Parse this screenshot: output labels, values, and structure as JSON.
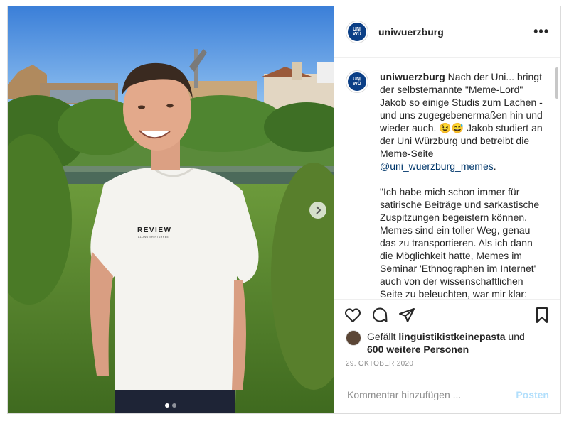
{
  "account": {
    "username": "uniwuerzburg",
    "avatar_text": "UNI WÜ"
  },
  "caption": {
    "username": "uniwuerzburg",
    "text_1": " Nach der Uni... bringt der selbsternannte \"Meme-Lord\" Jakob so einige Studis zum Lachen - und uns zugegebenermaßen hin und wieder auch. 😉😅 Jakob studiert an der Uni Würzburg und betreibt die Meme-Seite ",
    "mention": "@uni_wuerzburg_memes",
    "text_2": ".\n\n\"Ich habe mich schon immer für satirische Beiträge und sarkastische Zuspitzungen begeistern können. Memes sind ein toller Weg, genau das zu transportieren. Als ich dann die Möglichkeit hatte, Memes im Seminar 'Ethnographen im Internet' auch von der wissenschaftlichen Seite zu beleuchten, war mir klar: Die Uni Würzburg braucht unbedingt auch eine"
  },
  "photo": {
    "shirt_text": "REVIEW",
    "shirt_subtext": "ALONG SHIFTSHREE",
    "carousel_count": 2,
    "carousel_active": 0
  },
  "likes": {
    "prefix": "Gefällt ",
    "liker": "linguistikistkeinepasta",
    "middle": " und",
    "others": "600 weitere Personen"
  },
  "date": "29. OKTOBER 2020",
  "comment": {
    "placeholder": "Kommentar hinzufügen ...",
    "post_label": "Posten"
  },
  "icons": {
    "more": "more-options-icon",
    "like": "heart-icon",
    "comment": "comment-icon",
    "share": "share-icon",
    "save": "bookmark-icon",
    "next": "chevron-right-icon"
  },
  "colors": {
    "link": "#00376b",
    "post_button": "#b2dffc",
    "muted": "#8e8e8e",
    "brand": "#0b3f86"
  }
}
